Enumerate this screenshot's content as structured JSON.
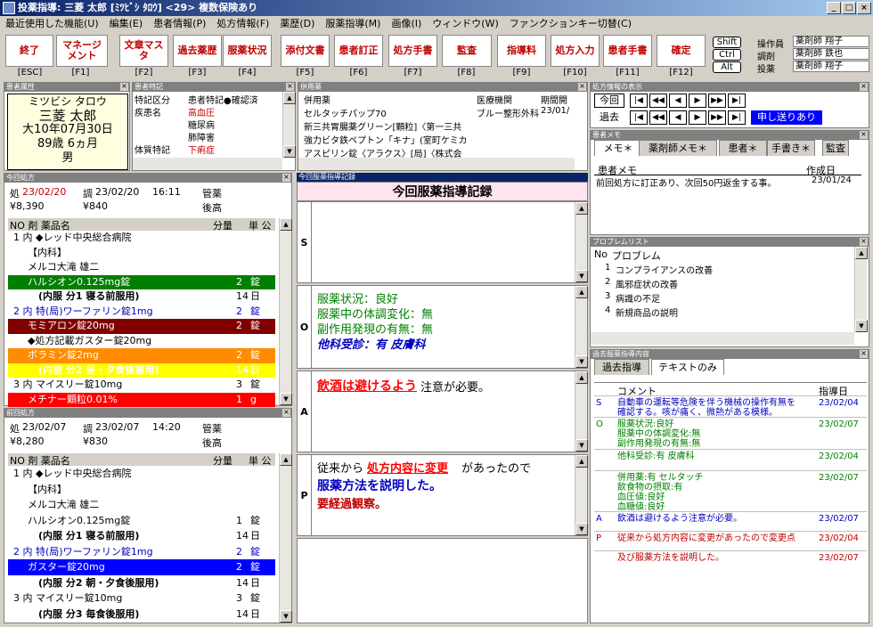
{
  "window": {
    "title": "投薬指導: 三菱 太郎 [ﾐﾂﾋﾞｼ ﾀﾛｳ] <29> 複数保険あり",
    "min": "_",
    "max": "□",
    "close": "×"
  },
  "menu": [
    "最近使用した機能(U)",
    "編集(E)",
    "患者情報(P)",
    "処方情報(F)",
    "薬歴(D)",
    "服薬指導(M)",
    "画像(I)",
    "ウィンドウ(W)",
    "ファンクションキー切替(C)"
  ],
  "fkeys": [
    {
      "label": "終了",
      "key": "[ESC]"
    },
    {
      "label": "マネージ\nメント",
      "key": "[F1]"
    },
    {
      "label": "文章マスタ",
      "key": "[F2]"
    },
    {
      "label": "過去薬歴",
      "key": "[F3]"
    },
    {
      "label": "服薬状況",
      "key": "[F4]"
    },
    {
      "label": "添付文書",
      "key": "[F5]"
    },
    {
      "label": "患者訂正",
      "key": "[F6]"
    },
    {
      "label": "処方手書",
      "key": "[F7]"
    },
    {
      "label": "監査",
      "key": "[F8]"
    },
    {
      "label": "指導料",
      "key": "[F9]"
    },
    {
      "label": "処方入力",
      "key": "[F10]"
    },
    {
      "label": "患者手書",
      "key": "[F11]"
    },
    {
      "label": "確定",
      "key": "[F12]"
    }
  ],
  "modifiers": [
    "Shift",
    "Ctrl",
    "Alt"
  ],
  "operators": [
    {
      "role": "操作員",
      "name": "薬剤師 翔子"
    },
    {
      "role": "調剤",
      "name": "薬剤師 鉄也"
    },
    {
      "role": "投薬",
      "name": "薬剤師 翔子"
    }
  ],
  "patient": {
    "header": "患者属性",
    "kana": "ミツビシ タロウ",
    "name": "三菱 太郎",
    "birth": "大10年07月30日",
    "age": "89歳 6ヵ月",
    "sex": "男"
  },
  "special": {
    "header": "患者特記",
    "rows": [
      [
        "特記区分",
        "患者特記●確認済"
      ],
      [
        "疾患名",
        "高血圧"
      ],
      [
        "",
        "糖尿病"
      ],
      [
        "",
        "肺障害"
      ],
      [
        "体質特記",
        "下痢症"
      ]
    ]
  },
  "heiyo": {
    "header": "併用薬",
    "cols": [
      "併用薬",
      "医療機関",
      "期間開"
    ],
    "rows": [
      [
        "セルタッチパップ70",
        "ブルー整形外科",
        "23/01/"
      ],
      [
        "新三共胃腸薬グリーン[顆粒]〈第一三共",
        "",
        ""
      ],
      [
        "強力ビタ鉄ペプトン「キナ」(室町ケミカ",
        "",
        ""
      ],
      [
        "アスピリン錠〈アラクス〉[局]〈株式会",
        "",
        ""
      ]
    ]
  },
  "rxhist": {
    "header": "処方情報の表示",
    "now": "今回",
    "past": "過去",
    "msg": "申し送りあり",
    "arrows": [
      "|◀",
      "◀◀",
      "◀",
      "▶",
      "▶▶",
      "▶|"
    ]
  },
  "memo": {
    "header": "患者メモ",
    "tabs": [
      "メモ＊",
      "薬剤師メモ＊",
      "患者＊",
      "手書き＊",
      "監査"
    ],
    "cols": [
      "患者メモ",
      "作成日"
    ],
    "row": [
      "前回処方に訂正あり、次回50円返金する事。",
      "23/01/24"
    ]
  },
  "problems": {
    "header": "プロブレムリスト",
    "cols": [
      "No",
      "プロブレム"
    ],
    "rows": [
      [
        "1",
        "コンプライアンスの改善"
      ],
      [
        "2",
        "風邪症状の改善"
      ],
      [
        "3",
        "病識の不足"
      ],
      [
        "4",
        "新規商品の説明"
      ]
    ]
  },
  "current": {
    "header": "今回処方",
    "c1": "処",
    "d1": "23/02/20",
    "c2": "調",
    "d2": "23/02/20",
    "time": "16:11",
    "tag": "管薬",
    "m1": "¥8,390",
    "m2": "¥840",
    "tag2": "後高",
    "cols": [
      "NO 剤 薬品名",
      "分量",
      "単 公"
    ],
    "rows": [
      {
        "t": "1 内 ◆レッド中央総合病院",
        "q": "",
        "u": "",
        "bg": "",
        "fg": "",
        "b": false
      },
      {
        "t": "【内科】",
        "q": "",
        "u": "",
        "bg": "",
        "fg": "",
        "b": false
      },
      {
        "t": "メルコ大滝 雄二",
        "q": "",
        "u": "",
        "bg": "",
        "fg": "",
        "b": false
      },
      {
        "t": "ハルシオン0.125mg錠",
        "q": "2",
        "u": "錠",
        "bg": "#008000",
        "fg": "#fff",
        "b": false
      },
      {
        "t": "(内服 分1 寝る前服用)",
        "q": "14",
        "u": "日",
        "bg": "",
        "fg": "",
        "b": true
      },
      {
        "t": "2 内 特(局)ワーファリン錠1mg",
        "q": "2",
        "u": "錠",
        "bg": "",
        "fg": "#0000c0",
        "b": false
      },
      {
        "t": "モミアロン錠20mg",
        "q": "2",
        "u": "錠",
        "bg": "#800000",
        "fg": "#fff",
        "b": false
      },
      {
        "t": "◆処方記載ガスター錠20mg",
        "q": "",
        "u": "",
        "bg": "",
        "fg": "",
        "b": false
      },
      {
        "t": "ボラミン錠2mg",
        "q": "2",
        "u": "錠",
        "bg": "#ff8c00",
        "fg": "#fff",
        "b": false
      },
      {
        "t": "(内服 分2 昼・夕食後服用)",
        "q": "14",
        "u": "日",
        "bg": "#ffff00",
        "fg": "#fff",
        "b": true
      },
      {
        "t": "3 内 マイスリー錠10mg",
        "q": "3",
        "u": "錠",
        "bg": "",
        "fg": "",
        "b": false
      },
      {
        "t": "メチナー顆粒0.01%",
        "q": "1",
        "u": "g",
        "bg": "#ff0000",
        "fg": "#fff",
        "b": false
      }
    ]
  },
  "previous": {
    "header": "前回処方",
    "c1": "処",
    "d1": "23/02/07",
    "c2": "調",
    "d2": "23/02/07",
    "time": "14:20",
    "tag": "管薬",
    "m1": "¥8,280",
    "m2": "¥830",
    "tag2": "後高",
    "cols": [
      "NO 剤 薬品名",
      "分量",
      "単 公"
    ],
    "rows": [
      {
        "t": "1 内 ◆レッド中央総合病院",
        "q": "",
        "u": "",
        "bg": "",
        "fg": "",
        "b": false
      },
      {
        "t": "【内科】",
        "q": "",
        "u": "",
        "bg": "",
        "fg": "",
        "b": false
      },
      {
        "t": "メルコ大滝 雄二",
        "q": "",
        "u": "",
        "bg": "",
        "fg": "",
        "b": false
      },
      {
        "t": "ハルシオン0.125mg錠",
        "q": "1",
        "u": "錠",
        "bg": "",
        "fg": "",
        "b": false
      },
      {
        "t": "(内服 分1 寝る前服用)",
        "q": "14",
        "u": "日",
        "bg": "",
        "fg": "",
        "b": true
      },
      {
        "t": "2 内 特(局)ワーファリン錠1mg",
        "q": "2",
        "u": "錠",
        "bg": "",
        "fg": "#0000c0",
        "b": false
      },
      {
        "t": "ガスター錠20mg",
        "q": "2",
        "u": "錠",
        "bg": "#0000ff",
        "fg": "#fff",
        "b": false
      },
      {
        "t": "(内服 分2 朝・夕食後服用)",
        "q": "14",
        "u": "日",
        "bg": "",
        "fg": "",
        "b": true
      },
      {
        "t": "3 内 マイスリー錠10mg",
        "q": "3",
        "u": "錠",
        "bg": "",
        "fg": "",
        "b": false
      },
      {
        "t": "(内服 分3 毎食後服用)",
        "q": "14",
        "u": "日",
        "bg": "",
        "fg": "",
        "b": true
      }
    ]
  },
  "soap": {
    "header": "今回服薬指導記録",
    "title": "今回服薬指導記録",
    "S": "S",
    "O": "O",
    "A": "A",
    "P": "P",
    "o1": "服薬状況：良好",
    "o2": "服薬中の体調変化：無",
    "o3": "副作用発現の有無：無",
    "o4": "他科受診：有 皮膚科",
    "a1": "飲酒は避けるよう",
    "a2": "注意が必要。",
    "p1": "従来から",
    "p2": "処方内容に変更",
    "p3": "があったので",
    "p4": "服薬方法を説明した。",
    "p5": "要経過観察。"
  },
  "pastGuide": {
    "header": "過去服薬指導内容",
    "tabs": [
      "過去指導",
      "テキストのみ"
    ],
    "cols": [
      "コメント",
      "指導日"
    ],
    "rows": [
      {
        "k": "S",
        "c": "自動車の運転等危険を伴う機械の操作有無を\n確認する。咳が痛く、微熱がある模様。",
        "d": "23/02/04",
        "col": "#0000c0",
        "h": 24
      },
      {
        "k": "O",
        "c": "服薬状況:良好\n服薬中の体調変化:無\n副作用発現の有無:無",
        "d": "23/02/07",
        "col": "#008000",
        "h": 36
      },
      {
        "k": "",
        "c": "他科受診:有 皮膚科",
        "d": "23/02/04",
        "col": "#008000",
        "h": 24
      },
      {
        "k": "",
        "c": "併用薬:有 セルタッチ\n飲食物の摂取:有\n血圧値:良好\n血糖値:良好",
        "d": "23/02/07",
        "col": "#008000",
        "h": 46
      },
      {
        "k": "A",
        "c": "飲酒は避けるよう注意が必要。",
        "d": "23/02/07",
        "col": "#0000c0",
        "h": 22
      },
      {
        "k": "P",
        "c": "従来から処方内容に変更があったので変更点",
        "d": "23/02/04",
        "col": "#c00000",
        "h": 22
      },
      {
        "k": "",
        "c": "及び服薬方法を説明した。",
        "d": "23/02/07",
        "col": "#c00000",
        "h": 20
      }
    ]
  }
}
